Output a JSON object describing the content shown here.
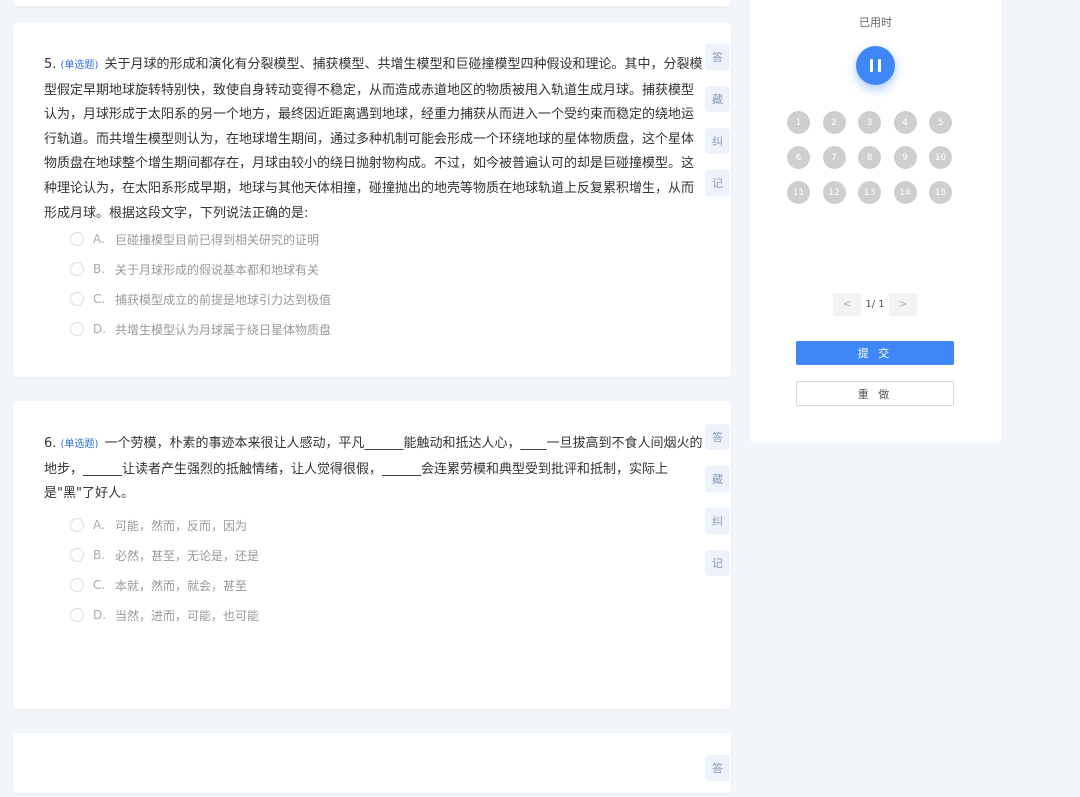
{
  "questions": [
    {
      "number": "5.",
      "type": "(单选题)",
      "text": "关于月球的形成和演化有分裂模型、捕获模型、共增生模型和巨碰撞模型四种假设和理论。其中，分裂模型假定早期地球旋转特别快，致使自身转动变得不稳定，从而造成赤道地区的物质被甩入轨道生成月球。捕获模型认为，月球形成于太阳系的另一个地方，最终因近距离遇到地球，经重力捕获从而进入一个受约束而稳定的绕地运行轨道。而共增生模型则认为，在地球增生期间，通过多种机制可能会形成一个环绕地球的星体物质盘，这个星体物质盘在地球整个增生期间都存在，月球由较小的绕日抛射物构成。不过，如今被普遍认可的却是巨碰撞模型。这种理论认为，在太阳系形成早期，地球与其他天体相撞，碰撞抛出的地壳等物质在地球轨道上反复累积增生，从而形成月球。根据这段文字，下列说法正确的是:",
      "options": [
        {
          "letter": "A.",
          "text": "巨碰撞模型目前已得到相关研究的证明"
        },
        {
          "letter": "B.",
          "text": "关于月球形成的假说基本都和地球有关"
        },
        {
          "letter": "C.",
          "text": "捕获模型成立的前提是地球引力达到极值"
        },
        {
          "letter": "D.",
          "text": "共增生模型认为月球属于绕日星体物质盘"
        }
      ]
    },
    {
      "number": "6.",
      "type": "(单选题)",
      "text": "一个劳模，朴素的事迹本来很让人感动，平凡______能触动和抵达人心，____一旦拔高到不食人间烟火的地步，______让读者产生强烈的抵触情绪，让人觉得很假，______会连累劳模和典型受到批评和抵制，实际上是\"黑\"了好人。",
      "options": [
        {
          "letter": "A.",
          "text": "可能，然而，反而，因为"
        },
        {
          "letter": "B.",
          "text": "必然，甚至，无论是，还是"
        },
        {
          "letter": "C.",
          "text": "本就，然而，就会，甚至"
        },
        {
          "letter": "D.",
          "text": "当然，进而，可能，也可能"
        }
      ]
    }
  ],
  "tools": [
    "答",
    "藏",
    "纠",
    "记"
  ],
  "panel": {
    "timer_label": "已用时",
    "question_numbers": [
      "1",
      "2",
      "3",
      "4",
      "5",
      "6",
      "7",
      "8",
      "9",
      "10",
      "11",
      "12",
      "13",
      "14",
      "15"
    ],
    "pager": {
      "prev": "<",
      "text": "1/ 1",
      "next": ">"
    },
    "submit_label": "提 交",
    "redo_label": "重 做"
  },
  "colors": {
    "accent": "#3f86f7",
    "type_tag": "#2f6fe0",
    "bubble": "#cfcfcf"
  }
}
